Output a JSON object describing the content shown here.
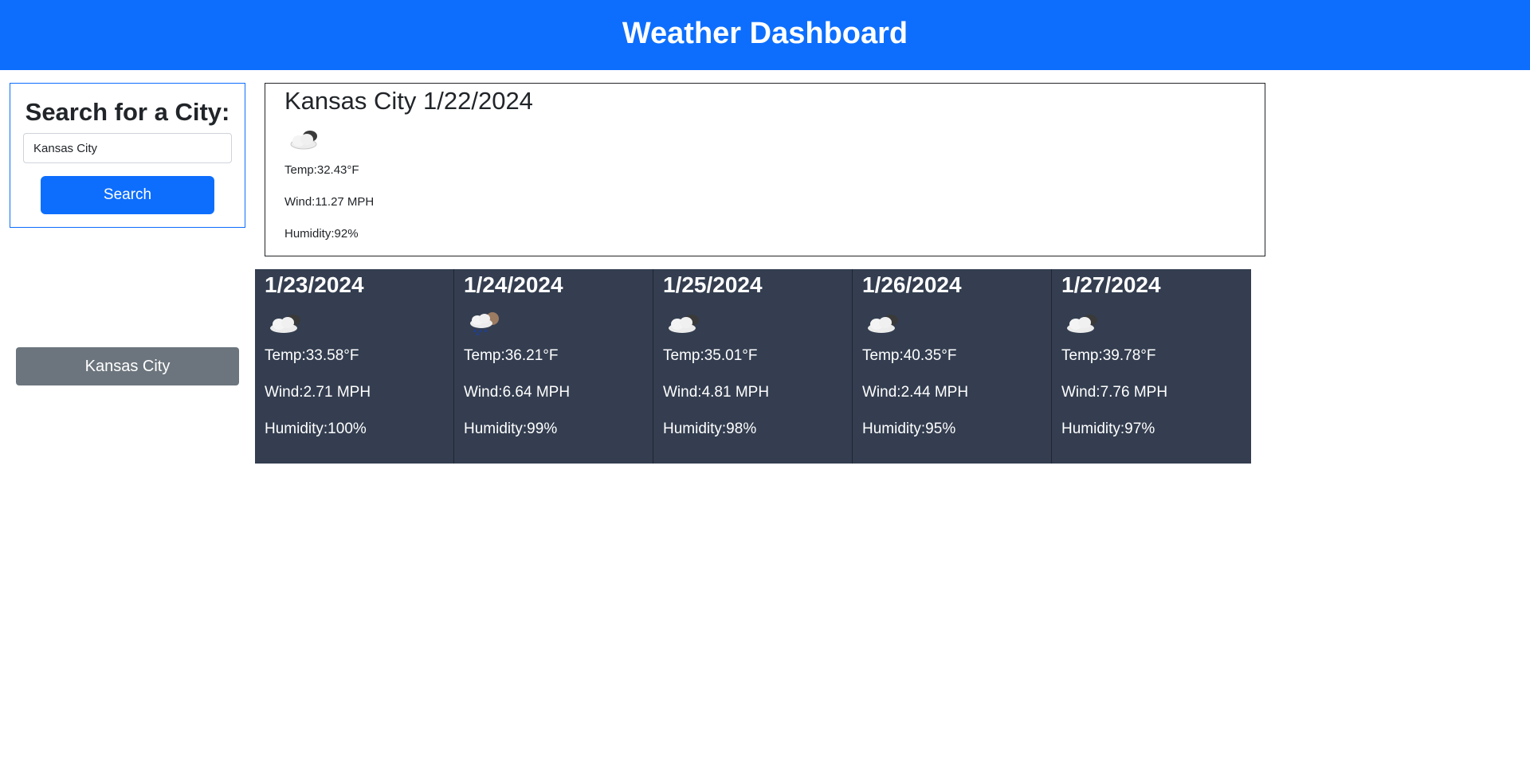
{
  "header": {
    "title": "Weather Dashboard"
  },
  "search": {
    "heading": "Search for a City:",
    "input_value": "Kansas City",
    "button_label": "Search"
  },
  "history": [
    {
      "label": "Kansas City"
    }
  ],
  "current": {
    "title": "Kansas City 1/22/2024",
    "icon": "cloud-icon",
    "temp": "Temp:32.43°F",
    "wind": "Wind:11.27 MPH",
    "humidity": "Humidity:92%"
  },
  "forecast": [
    {
      "date": "1/23/2024",
      "icon": "cloud-icon",
      "temp": "Temp:33.58°F",
      "wind": "Wind:2.71 MPH",
      "humidity": "Humidity:100%"
    },
    {
      "date": "1/24/2024",
      "icon": "rain-icon",
      "temp": "Temp:36.21°F",
      "wind": "Wind:6.64 MPH",
      "humidity": "Humidity:99%"
    },
    {
      "date": "1/25/2024",
      "icon": "cloud-icon",
      "temp": "Temp:35.01°F",
      "wind": "Wind:4.81 MPH",
      "humidity": "Humidity:98%"
    },
    {
      "date": "1/26/2024",
      "icon": "cloud-icon",
      "temp": "Temp:40.35°F",
      "wind": "Wind:2.44 MPH",
      "humidity": "Humidity:95%"
    },
    {
      "date": "1/27/2024",
      "icon": "cloud-icon",
      "temp": "Temp:39.78°F",
      "wind": "Wind:7.76 MPH",
      "humidity": "Humidity:97%"
    }
  ],
  "colors": {
    "primary": "#0d6efd",
    "secondary": "#6c757d",
    "forecast_card": "#343e50"
  }
}
